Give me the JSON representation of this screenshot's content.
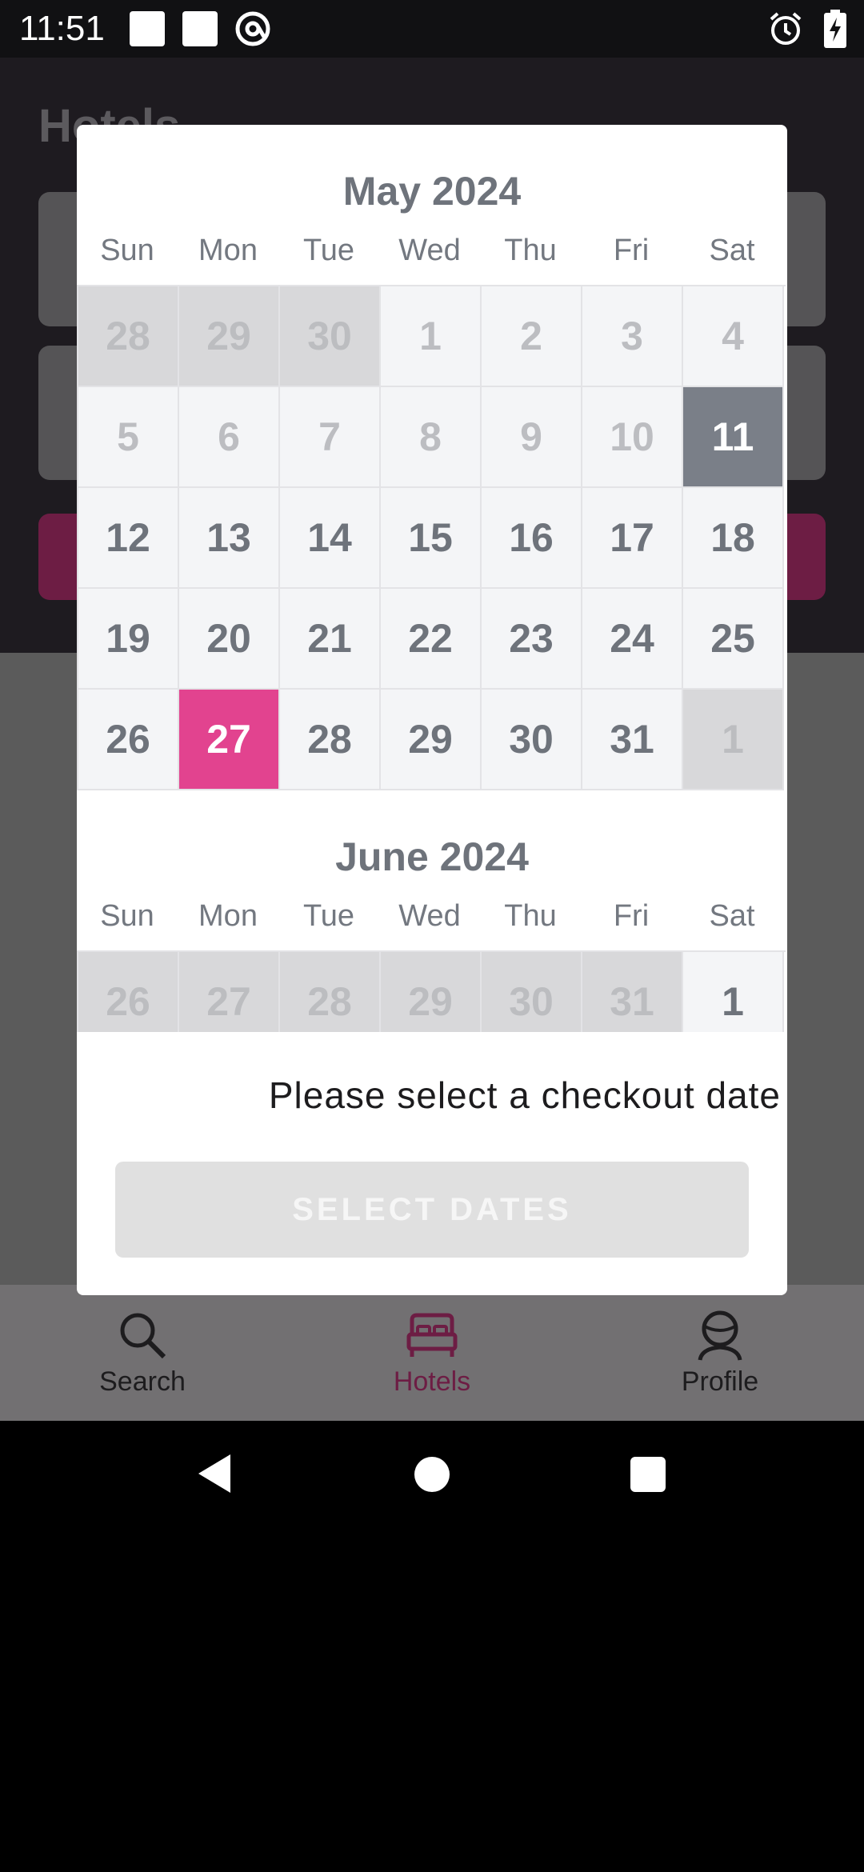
{
  "status_bar": {
    "time": "11:51",
    "icons": [
      "square-notification-icon",
      "square-notification-icon",
      "at-sign-icon",
      "alarm-icon",
      "battery-charging-icon"
    ]
  },
  "background_app": {
    "title": "Hotels",
    "accent": "#6d1d44"
  },
  "calendar": {
    "weekdays": [
      "Sun",
      "Mon",
      "Tue",
      "Wed",
      "Thu",
      "Fri",
      "Sat"
    ],
    "months": [
      {
        "title": "May 2024",
        "weeks": [
          [
            {
              "d": "28",
              "s": "outside"
            },
            {
              "d": "29",
              "s": "outside"
            },
            {
              "d": "30",
              "s": "outside"
            },
            {
              "d": "1",
              "s": "disabled"
            },
            {
              "d": "2",
              "s": "disabled"
            },
            {
              "d": "3",
              "s": "disabled"
            },
            {
              "d": "4",
              "s": "disabled"
            }
          ],
          [
            {
              "d": "5",
              "s": "disabled"
            },
            {
              "d": "6",
              "s": "disabled"
            },
            {
              "d": "7",
              "s": "disabled"
            },
            {
              "d": "8",
              "s": "disabled"
            },
            {
              "d": "9",
              "s": "disabled"
            },
            {
              "d": "10",
              "s": "disabled"
            },
            {
              "d": "11",
              "s": "checkin"
            }
          ],
          [
            {
              "d": "12",
              "s": "normal"
            },
            {
              "d": "13",
              "s": "normal"
            },
            {
              "d": "14",
              "s": "normal"
            },
            {
              "d": "15",
              "s": "normal"
            },
            {
              "d": "16",
              "s": "normal"
            },
            {
              "d": "17",
              "s": "normal"
            },
            {
              "d": "18",
              "s": "normal"
            }
          ],
          [
            {
              "d": "19",
              "s": "normal"
            },
            {
              "d": "20",
              "s": "normal"
            },
            {
              "d": "21",
              "s": "normal"
            },
            {
              "d": "22",
              "s": "normal"
            },
            {
              "d": "23",
              "s": "normal"
            },
            {
              "d": "24",
              "s": "normal"
            },
            {
              "d": "25",
              "s": "normal"
            }
          ],
          [
            {
              "d": "26",
              "s": "normal"
            },
            {
              "d": "27",
              "s": "today"
            },
            {
              "d": "28",
              "s": "normal"
            },
            {
              "d": "29",
              "s": "normal"
            },
            {
              "d": "30",
              "s": "normal"
            },
            {
              "d": "31",
              "s": "normal"
            },
            {
              "d": "1",
              "s": "outside"
            }
          ]
        ]
      },
      {
        "title": "June 2024",
        "weeks": [
          [
            {
              "d": "26",
              "s": "outside"
            },
            {
              "d": "27",
              "s": "outside"
            },
            {
              "d": "28",
              "s": "outside"
            },
            {
              "d": "29",
              "s": "outside"
            },
            {
              "d": "30",
              "s": "outside"
            },
            {
              "d": "31",
              "s": "outside"
            },
            {
              "d": "1",
              "s": "normal"
            }
          ]
        ]
      }
    ],
    "colors": {
      "checkin": "#7a7f88",
      "today": "#e2438f"
    }
  },
  "dialog": {
    "hint": "Please select a checkout date",
    "button_label": "SELECT DATES"
  },
  "bottom_nav": {
    "items": [
      {
        "label": "Search",
        "icon": "search-icon"
      },
      {
        "label": "Hotels",
        "icon": "bed-icon",
        "active": true
      },
      {
        "label": "Profile",
        "icon": "profile-icon"
      }
    ]
  }
}
